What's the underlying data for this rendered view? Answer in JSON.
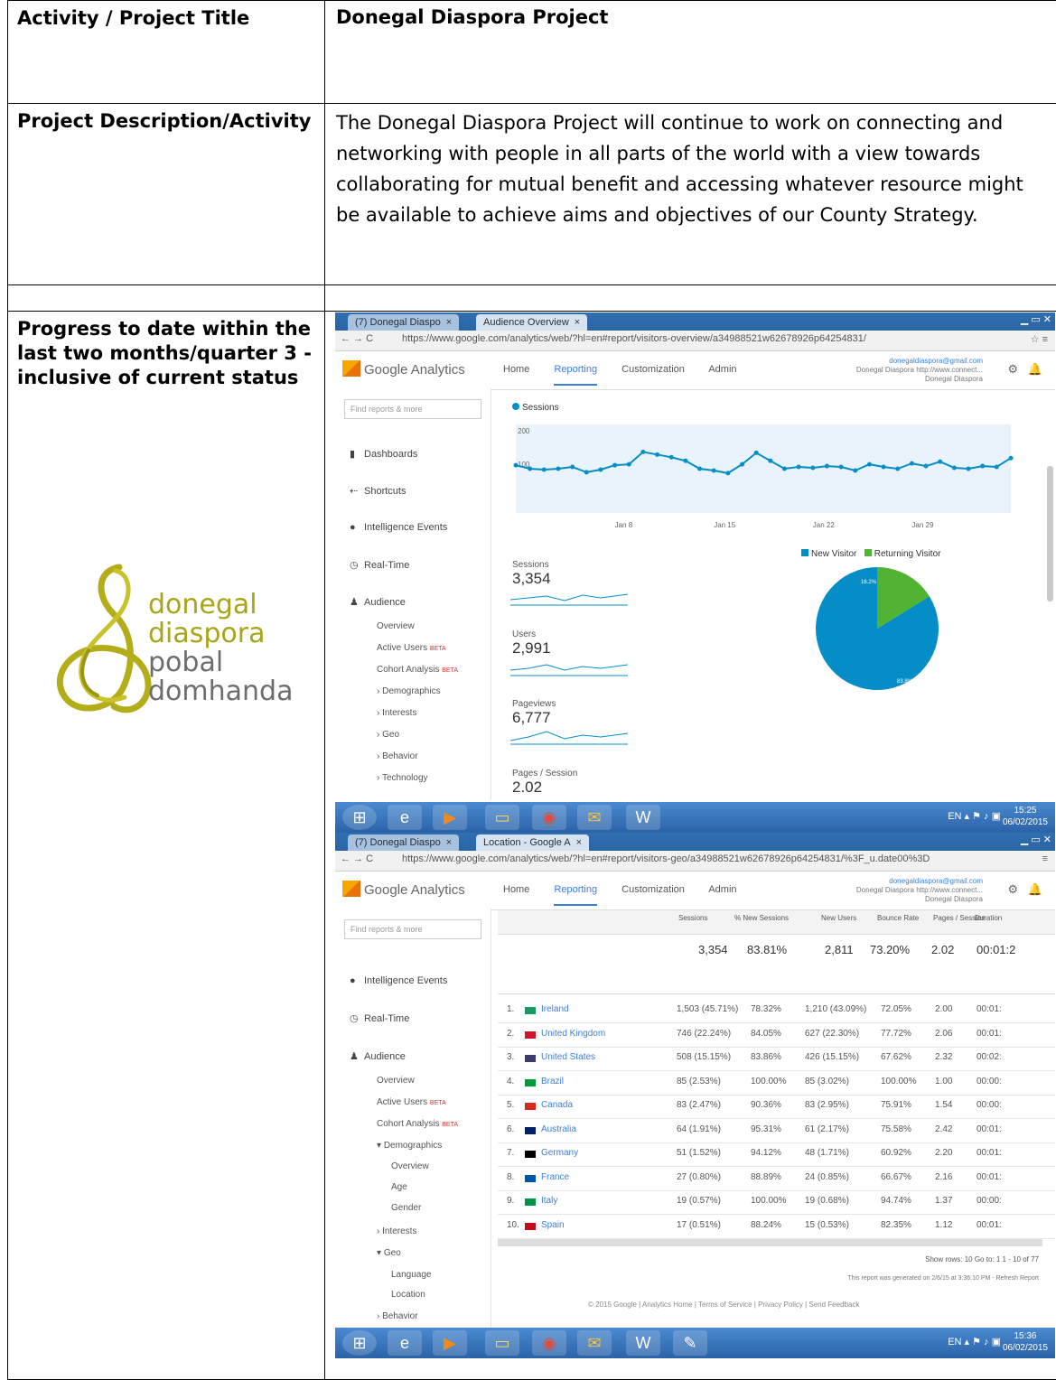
{
  "rows": {
    "title_label": "Activity / Project Title",
    "title_value": "Donegal Diaspora Project",
    "desc_label": "Project Description/Activity",
    "desc_value": "The Donegal Diaspora Project will continue to work on connecting and networking with people in all parts of the world with a view towards collaborating for mutual benefit and accessing whatever resource might be available to achieve aims and objectives of our County Strategy.",
    "progress_label": "Progress to date within the last two months/quarter 3 - inclusive of current status"
  },
  "logo": {
    "line1": "donegal",
    "line2": "diaspora",
    "line3": "pobal",
    "line4": "domhanda"
  },
  "browser": {
    "tab1": "(7) Donegal Diaspo",
    "tab2_overview": "Audience Overview",
    "tab2_location": "Location - Google A",
    "url_overview": "https://www.google.com/analytics/web/?hl=en#report/visitors-overview/a34988521w62678926p64254831/",
    "url_location": "https://www.google.com/analytics/web/?hl=en#report/visitors-geo/a34988521w62678926p64254831/%3F_u.date00%3D"
  },
  "ga": {
    "product": "Google Analytics",
    "menu": [
      "Home",
      "Reporting",
      "Customization",
      "Admin"
    ],
    "account_email": "donegaldiaspora@gmail.com",
    "account_name": "Donegal Diaspora",
    "account_site": "http://www.connect...",
    "account_view": "Donegal Diaspora",
    "search_placeholder": "Find reports & more",
    "sidebar": [
      "Dashboards",
      "Shortcuts",
      "Intelligence Events",
      "Real-Time",
      "Audience"
    ],
    "audience_sub": [
      "Overview",
      "Active Users",
      "Cohort Analysis",
      "Demographics",
      "Interests",
      "Geo",
      "Behavior",
      "Technology"
    ],
    "demographics_sub": [
      "Overview",
      "Age",
      "Gender"
    ],
    "geo_sub": [
      "Language",
      "Location"
    ],
    "beta": "BETA"
  },
  "overview": {
    "series_label": "Sessions",
    "y_top": "200",
    "y_mid": "100",
    "x_labels": [
      "Jan 8",
      "Jan 15",
      "Jan 22",
      "Jan 29"
    ],
    "legend": [
      "New Visitor",
      "Returning Visitor"
    ],
    "metrics": [
      {
        "label": "Sessions",
        "value": "3,354"
      },
      {
        "label": "Users",
        "value": "2,991"
      },
      {
        "label": "Pageviews",
        "value": "6,777"
      },
      {
        "label": "Pages / Session",
        "value": "2.02"
      }
    ],
    "pie_new_label": "83.8%",
    "pie_ret_label": "16.2%",
    "colors": {
      "line": "#058dc7",
      "new": "#058dc7",
      "returning": "#50b432"
    }
  },
  "chart_data": {
    "type": "line",
    "x": [
      "Jan 1",
      "Jan 2",
      "Jan 3",
      "Jan 4",
      "Jan 5",
      "Jan 6",
      "Jan 7",
      "Jan 8",
      "Jan 9",
      "Jan 10",
      "Jan 11",
      "Jan 12",
      "Jan 13",
      "Jan 14",
      "Jan 15",
      "Jan 16",
      "Jan 17",
      "Jan 18",
      "Jan 19",
      "Jan 20",
      "Jan 21",
      "Jan 22",
      "Jan 23",
      "Jan 24",
      "Jan 25",
      "Jan 26",
      "Jan 27",
      "Jan 28",
      "Jan 29",
      "Jan 30",
      "Jan 31",
      "Feb 1",
      "Feb 2",
      "Feb 3",
      "Feb 4",
      "Feb 5"
    ],
    "series": [
      {
        "name": "Sessions",
        "values": [
          108,
          100,
          98,
          100,
          104,
          92,
          98,
          108,
          110,
          138,
          132,
          126,
          118,
          100,
          96,
          90,
          110,
          136,
          118,
          100,
          104,
          102,
          106,
          104,
          96,
          110,
          104,
          100,
          112,
          106,
          116,
          102,
          100,
          106,
          104,
          124
        ]
      }
    ],
    "ylim": [
      0,
      200
    ]
  },
  "location": {
    "header_cols": [
      "Sessions",
      "% New Sessions",
      "New Users",
      "Bounce Rate",
      "Pages / Session",
      "Duration"
    ],
    "totals": [
      "3,354",
      "83.81%",
      "2,811",
      "73.20%",
      "2.02",
      "00:01:2"
    ],
    "rows": [
      {
        "n": "1.",
        "country": "Ireland",
        "sessions": "1,503 (45.71%)",
        "new": "78.32%",
        "users": "1,210 (43.09%)",
        "bounce": "72.05%",
        "pps": "2.00",
        "dur": "00:01:"
      },
      {
        "n": "2.",
        "country": "United Kingdom",
        "sessions": "746 (22.24%)",
        "new": "84.05%",
        "users": "627 (22.30%)",
        "bounce": "77.72%",
        "pps": "2.06",
        "dur": "00:01:"
      },
      {
        "n": "3.",
        "country": "United States",
        "sessions": "508 (15.15%)",
        "new": "83.86%",
        "users": "426 (15.15%)",
        "bounce": "67.62%",
        "pps": "2.32",
        "dur": "00:02:"
      },
      {
        "n": "4.",
        "country": "Brazil",
        "sessions": "85 (2.53%)",
        "new": "100.00%",
        "users": "85 (3.02%)",
        "bounce": "100.00%",
        "pps": "1.00",
        "dur": "00:00:"
      },
      {
        "n": "5.",
        "country": "Canada",
        "sessions": "83 (2.47%)",
        "new": "90.36%",
        "users": "83 (2.95%)",
        "bounce": "75.91%",
        "pps": "1.54",
        "dur": "00:00:"
      },
      {
        "n": "6.",
        "country": "Australia",
        "sessions": "64 (1.91%)",
        "new": "95.31%",
        "users": "61 (2.17%)",
        "bounce": "75.58%",
        "pps": "2.42",
        "dur": "00:01:"
      },
      {
        "n": "7.",
        "country": "Germany",
        "sessions": "51 (1.52%)",
        "new": "94.12%",
        "users": "48 (1.71%)",
        "bounce": "60.92%",
        "pps": "2.20",
        "dur": "00:01:"
      },
      {
        "n": "8.",
        "country": "France",
        "sessions": "27 (0.80%)",
        "new": "88.89%",
        "users": "24 (0.85%)",
        "bounce": "66.67%",
        "pps": "2.16",
        "dur": "00:01:"
      },
      {
        "n": "9.",
        "country": "Italy",
        "sessions": "19 (0.57%)",
        "new": "100.00%",
        "users": "19 (0.68%)",
        "bounce": "94.74%",
        "pps": "1.37",
        "dur": "00:00:"
      },
      {
        "n": "10.",
        "country": "Spain",
        "sessions": "17 (0.51%)",
        "new": "88.24%",
        "users": "15 (0.53%)",
        "bounce": "82.35%",
        "pps": "1.12",
        "dur": "00:01:"
      }
    ],
    "pager": "Show rows: 10   Go to: 1   1 - 10 of 77",
    "generated": "This report was generated on 2/6/15 at 3:36:10 PM - Refresh Report",
    "footer": "© 2015 Google | Analytics Home | Terms of Service | Privacy Policy | Send Feedback"
  },
  "taskbar": {
    "lang": "EN",
    "time1": "15:25",
    "date1": "06/02/2015",
    "time2": "15:36",
    "date2": "06/02/2015"
  }
}
